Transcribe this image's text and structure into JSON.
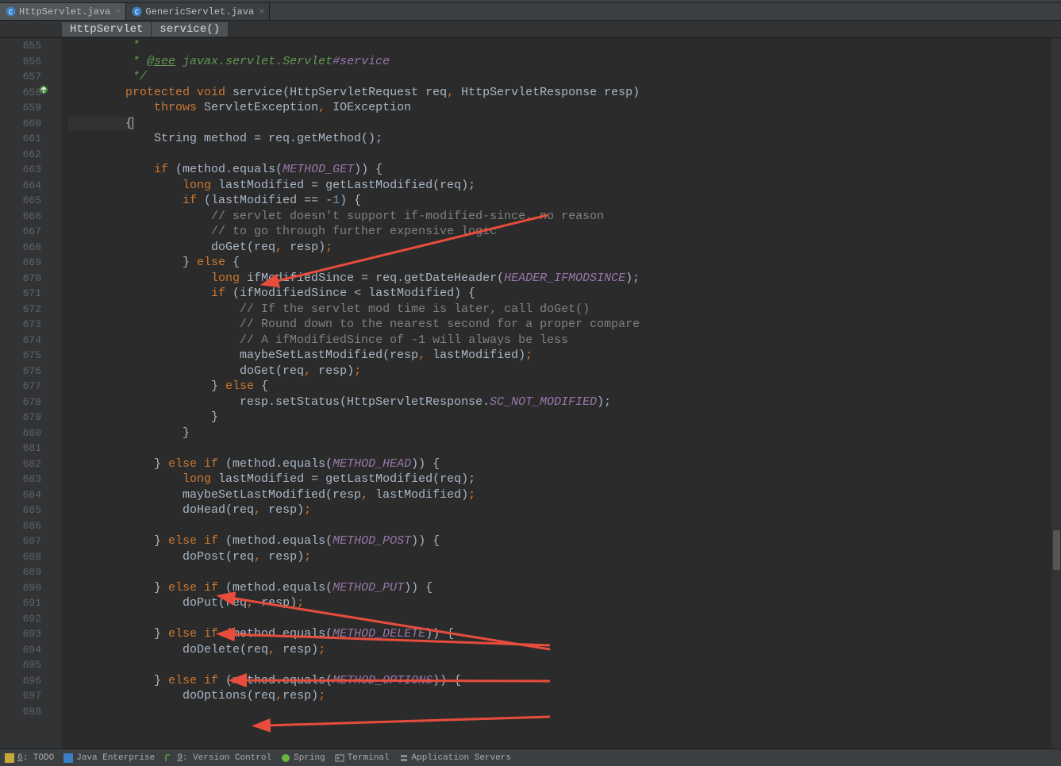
{
  "tabs": [
    {
      "name": "HttpServlet.java",
      "active": true
    },
    {
      "name": "GenericServlet.java",
      "active": false
    }
  ],
  "breadcrumb": {
    "class": "HttpServlet",
    "method": "service()"
  },
  "gutter": {
    "start": 655,
    "end": 698
  },
  "code": {
    "l655": {
      "pre": "        * ",
      "star": "*"
    },
    "l656": {
      "doc_pre": "         * ",
      "see": "@see",
      "rest": " javax.servlet.Servlet",
      "hash": "#service"
    },
    "l657_close": "         */",
    "l658": {
      "mods": "protected void",
      "name": " service",
      "sig": "(HttpServletRequest req",
      "c1": ",",
      "sig2": " HttpServletResponse resp)"
    },
    "l659": {
      "pre": "            ",
      "kw": "throws",
      "rest": " ServletException",
      "c": ",",
      "rest2": " IOException"
    },
    "l660": "        {",
    "l661": "            String method = req.getMethod();",
    "l663": {
      "pre": "            ",
      "kw": "if",
      "rest": " (method.equals(",
      "c": "METHOD_GET",
      "end": ")) {"
    },
    "l664": {
      "pre": "                ",
      "kw": "long",
      "rest": " lastModified = getLastModified(req);"
    },
    "l665": {
      "pre": "                ",
      "kw": "if",
      "rest": " (lastModified == -",
      "n": "1",
      "end": ") {"
    },
    "l666": "                    // servlet doesn't support if-modified-since, no reason",
    "l667": "                    // to go through further expensive logic",
    "l668": {
      "pre": "                    doGet(req",
      "c": ",",
      "rest": " resp)",
      ";": ";"
    },
    "l669": {
      "pre": "                } ",
      "kw": "else",
      "rest": " {"
    },
    "l670": {
      "pre": "                    ",
      "kw": "long",
      "rest": " ifModifiedSince = req.getDateHeader(",
      "c": "HEADER_IFMODSINCE",
      "end": ");"
    },
    "l671": {
      "pre": "                    ",
      "kw": "if",
      "rest": " (ifModifiedSince < lastModified) {"
    },
    "l672": "                        // If the servlet mod time is later, call doGet()",
    "l673": "                        // Round down to the nearest second for a proper compare",
    "l674": "                        // A ifModifiedSince of -1 will always be less",
    "l675": {
      "pre": "                        maybeSetLastModified(resp",
      "c": ",",
      "rest": " lastModified)",
      ";": ";"
    },
    "l676": {
      "pre": "                        doGet(req",
      "c": ",",
      "rest": " resp)",
      ";": ";"
    },
    "l677": {
      "pre": "                    } ",
      "kw": "else",
      "rest": " {"
    },
    "l678": {
      "pre": "                        resp.setStatus(HttpServletResponse.",
      "c": "SC_NOT_MODIFIED",
      "end": ");"
    },
    "l679": "                    }",
    "l680": "                }",
    "l682": {
      "pre": "            } ",
      "kw": "else if",
      "rest": " (method.equals(",
      "c": "METHOD_HEAD",
      "end": ")) {"
    },
    "l683": {
      "pre": "                ",
      "kw": "long",
      "rest": " lastModified = getLastModified(req);"
    },
    "l684": {
      "pre": "                maybeSetLastModified(resp",
      "c": ",",
      "rest": " lastModified)",
      ";": ";"
    },
    "l685": {
      "pre": "                doHead(req",
      "c": ",",
      "rest": " resp)",
      ";": ";"
    },
    "l687": {
      "pre": "            } ",
      "kw": "else if",
      "rest": " (method.equals(",
      "c": "METHOD_POST",
      "end": ")) {"
    },
    "l688": {
      "pre": "                doPost(req",
      "c": ",",
      "rest": " resp)",
      ";": ";"
    },
    "l690": {
      "pre": "            } ",
      "kw": "else if",
      "rest": " (method.equals(",
      "c": "METHOD_PUT",
      "end": ")) {"
    },
    "l691": {
      "pre": "                doPut(req",
      "c": ",",
      "rest": " resp)",
      ";": ";"
    },
    "l693": {
      "pre": "            } ",
      "kw": "else if",
      "rest": " (method.equals(",
      "c": "METHOD_DELETE",
      "end": ")) {"
    },
    "l694": {
      "pre": "                doDelete(req",
      "c": ",",
      "rest": " resp)",
      ";": ";"
    },
    "l696": {
      "pre": "            } ",
      "kw": "else if",
      "rest": " (method.equals(",
      "c": "METHOD_OPTIONS",
      "end": ")) {"
    },
    "l697": {
      "pre": "                doOptions(req",
      "c": ",",
      "rest": "resp)",
      ";": ";"
    }
  },
  "tools": {
    "todo": "TODO",
    "todo_u": "6",
    "je": "Java Enterprise",
    "vc": "Version Control",
    "vc_u": "9",
    "spring": "Spring",
    "term": "Terminal",
    "as": "Application Servers"
  }
}
